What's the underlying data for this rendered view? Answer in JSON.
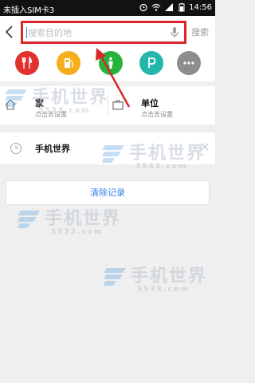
{
  "status_bar": {
    "carrier": "未插入SIM卡3",
    "time": "14:56"
  },
  "search": {
    "placeholder": "搜索目的地",
    "search_label": "搜索"
  },
  "categories": [
    {
      "name": "food",
      "icon": "fork-knife-icon",
      "color": "#e2322d"
    },
    {
      "name": "gas-station",
      "icon": "gas-pump-icon",
      "color": "#f3b01c"
    },
    {
      "name": "toilet",
      "icon": "toilet-icon",
      "color": "#27b33b"
    },
    {
      "name": "parking",
      "icon": "parking-icon",
      "color": "#24b6a9"
    },
    {
      "name": "more",
      "icon": "more-icon",
      "color": "#8d8d8d"
    }
  ],
  "home": {
    "title": "家",
    "subtitle": "点击去设置"
  },
  "work": {
    "title": "单位",
    "subtitle": "点击去设置"
  },
  "history": [
    {
      "text": "手机世界"
    }
  ],
  "clear_label": "清除记录",
  "watermark": {
    "text": "手机世界",
    "number": "3533.com"
  },
  "colors": {
    "highlight_red": "#d9252c",
    "link_blue": "#2f7ee6"
  }
}
